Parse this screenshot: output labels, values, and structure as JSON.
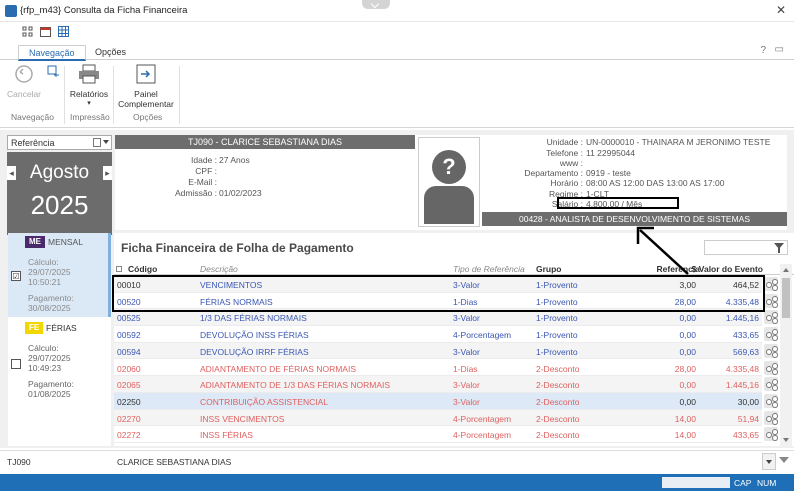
{
  "window": {
    "title": "{rfp_m43}  Consulta da Ficha Financeira"
  },
  "tabs": [
    {
      "label": "Navegação"
    },
    {
      "label": "Opções"
    }
  ],
  "ribbon": {
    "cancel_label": "Cancelar",
    "reports_label": "Relatórios",
    "reports_sub": "▾",
    "panel_label_1": "Painel",
    "panel_label_2": "Complementar",
    "group_navigation": "Navegação",
    "group_print": "Impressão",
    "group_options": "Opções"
  },
  "reference": {
    "select_label": "Referência",
    "month": "Agosto",
    "year": "2025"
  },
  "employee": {
    "header": "TJ090 - CLARICE SEBASTIANA DIAS",
    "idade_label": "Idade :",
    "idade_value": "27 Anos",
    "cpf_label": "CPF :",
    "email_label": "E-Mail :",
    "admissao_label": "Admissão :",
    "admissao_value": "01/02/2023",
    "unidade_label": "Unidade :",
    "unidade_value": "UN-0000010 - THAINARA M JERONIMO TESTE",
    "telefone_label": "Telefone :",
    "telefone_value": "11 22995044",
    "www_label": "www :",
    "departamento_label": "Departamento :",
    "departamento_value": "0919 - teste",
    "horario_label": "Horário :",
    "horario_value": "08:00 AS 12:00 DAS 13:00 AS 17:00",
    "regime_label": "Regime :",
    "regime_value": "1-CLT",
    "salario_label": "Salário :",
    "salario_value": "4.800,00 / Mês",
    "cargo": "00428 - ANALISTA DE DESENVOLVIMENTO DE SISTEMAS"
  },
  "folhas": [
    {
      "badge": "ME",
      "title": "MENSAL",
      "calc_label": "Cálculo:",
      "calc_date": "29/07/2025",
      "calc_time": "10:50:21",
      "pay_label": "Pagamento:",
      "pay_date": "30/08/2025",
      "checked": "☑"
    },
    {
      "badge": "FE",
      "title": "FÉRIAS",
      "calc_label": "Cálculo:",
      "calc_date": "29/07/2025",
      "calc_time": "10:49:23",
      "pay_label": "Pagamento:",
      "pay_date": "01/08/2025",
      "checked": ""
    }
  ],
  "grid": {
    "title": "Ficha Financeira de Folha de Pagamento",
    "headers": {
      "codigo": "Código",
      "descricao": "Descrição",
      "tipo": "Tipo de Referência",
      "grupo": "Grupo",
      "referencia": "Referência",
      "valor": "$ Valor do Evento"
    },
    "rows": [
      {
        "codigo": "00010",
        "descricao": "VENCIMENTOS",
        "tipo": "3-Valor",
        "grupo": "1-Provento",
        "referencia": "3,00",
        "valor": "464,52"
      },
      {
        "codigo": "00520",
        "descricao": "FÉRIAS NORMAIS",
        "tipo": "1-Dias",
        "grupo": "1-Provento",
        "referencia": "28,00",
        "valor": "4.335,48"
      },
      {
        "codigo": "00525",
        "descricao": "1/3 DAS FÉRIAS NORMAIS",
        "tipo": "3-Valor",
        "grupo": "1-Provento",
        "referencia": "0,00",
        "valor": "1.445,16"
      },
      {
        "codigo": "00592",
        "descricao": "DEVOLUÇÃO INSS FÉRIAS",
        "tipo": "4-Porcentagem",
        "grupo": "1-Provento",
        "referencia": "0,00",
        "valor": "433,65"
      },
      {
        "codigo": "00594",
        "descricao": "DEVOLUÇÃO IRRF FÉRIAS",
        "tipo": "3-Valor",
        "grupo": "1-Provento",
        "referencia": "0,00",
        "valor": "569,63"
      },
      {
        "codigo": "02060",
        "descricao": "ADIANTAMENTO DE FÉRIAS NORMAIS",
        "tipo": "1-Dias",
        "grupo": "2-Desconto",
        "referencia": "28,00",
        "valor": "4.335,48"
      },
      {
        "codigo": "02065",
        "descricao": "ADIANTAMENTO DE 1/3 DAS FÉRIAS NORMAIS",
        "tipo": "3-Valor",
        "grupo": "2-Desconto",
        "referencia": "0,00",
        "valor": "1.445,16"
      },
      {
        "codigo": "02250",
        "descricao": "CONTRIBUIÇÃO ASSISTENCIAL",
        "tipo": "3-Valor",
        "grupo": "2-Desconto",
        "referencia": "0,00",
        "valor": "30,00"
      },
      {
        "codigo": "02270",
        "descricao": "INSS VENCIMENTOS",
        "tipo": "4-Porcentagem",
        "grupo": "2-Desconto",
        "referencia": "14,00",
        "valor": "51,94"
      },
      {
        "codigo": "02272",
        "descricao": "INSS FÉRIAS",
        "tipo": "4-Porcentagem",
        "grupo": "2-Desconto",
        "referencia": "14,00",
        "valor": "433,65"
      }
    ]
  },
  "footer": {
    "code": "TJ090",
    "name": "CLARICE SEBASTIANA DIAS"
  },
  "status": {
    "cap": "CAP",
    "num": "NUM"
  },
  "colors": {
    "accent": "#2b6cb0",
    "provento": "#3a57b3",
    "desconto": "#e06060",
    "statusbar": "#1f6fb7"
  }
}
